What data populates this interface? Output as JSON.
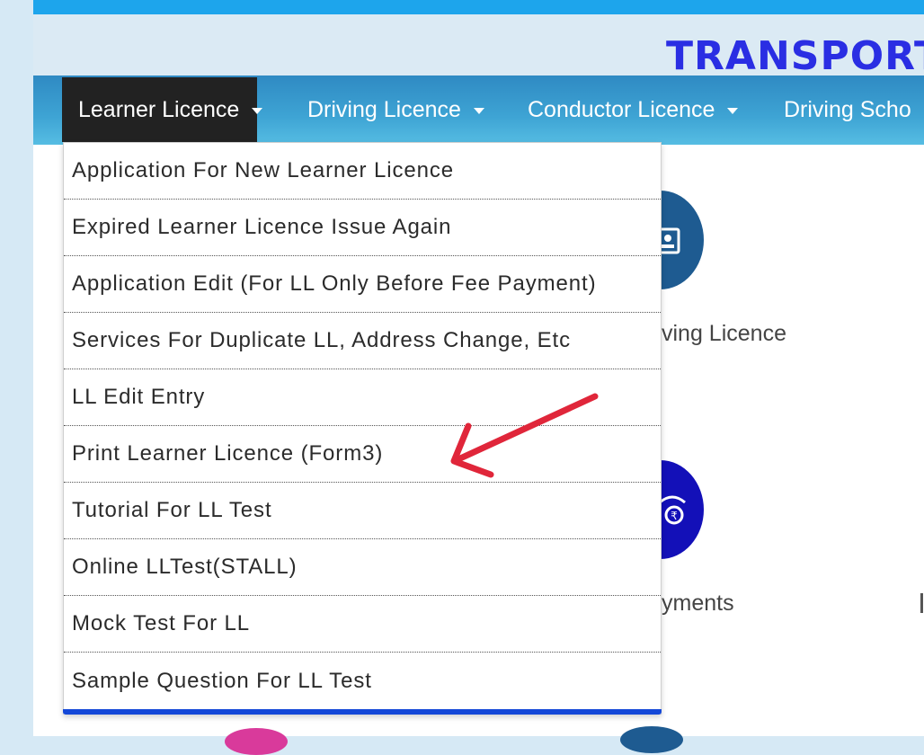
{
  "header": {
    "brand": "TRANSPORT"
  },
  "nav": {
    "items": [
      {
        "label": "Learner Licence",
        "active": true
      },
      {
        "label": "Driving Licence"
      },
      {
        "label": "Conductor Licence"
      },
      {
        "label": "Driving Scho"
      }
    ]
  },
  "background": {
    "driving_licence_label": "ving Licence",
    "payments_label": "yments"
  },
  "dropdown": {
    "items": [
      {
        "label": "Application For New Learner Licence"
      },
      {
        "label": "Expired Learner Licence Issue Again"
      },
      {
        "label": "Application Edit (For LL Only Before Fee Payment)"
      },
      {
        "label": "Services For Duplicate LL, Address Change, Etc"
      },
      {
        "label": "LL Edit Entry"
      },
      {
        "label": "Print Learner Licence (Form3)"
      },
      {
        "label": "Tutorial For LL Test"
      },
      {
        "label": "Online LLTest(STALL)"
      },
      {
        "label": "Mock Test For LL"
      },
      {
        "label": "Sample Question For LL Test"
      }
    ],
    "accent_color": "#1448d8"
  },
  "annotation": {
    "arrow_color": "#e0263a",
    "points_to": "Print Learner Licence (Form3)"
  },
  "colors": {
    "topbar": "#1da5ec",
    "brand": "#2a2ee3",
    "nav_active_bg": "#222222"
  }
}
